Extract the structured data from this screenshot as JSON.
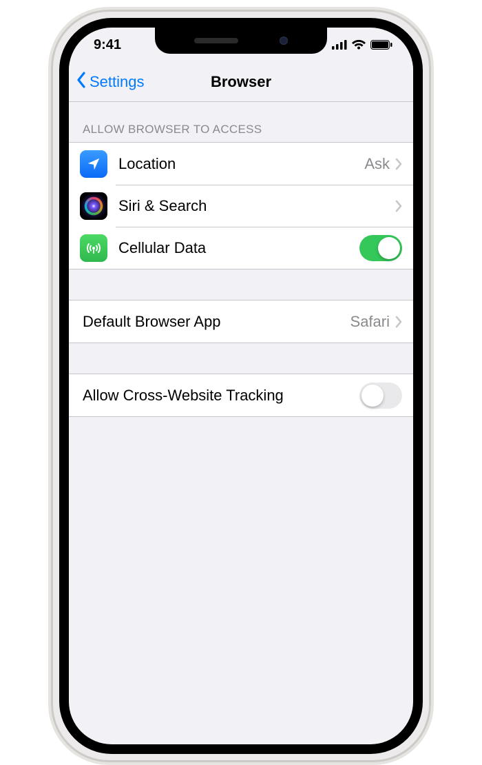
{
  "status": {
    "time": "9:41"
  },
  "nav": {
    "back_label": "Settings",
    "title": "Browser"
  },
  "section1": {
    "header": "ALLOW BROWSER TO ACCESS",
    "location": {
      "label": "Location",
      "value": "Ask"
    },
    "siri": {
      "label": "Siri & Search"
    },
    "cellular": {
      "label": "Cellular Data",
      "on": true
    }
  },
  "section2": {
    "default_browser": {
      "label": "Default Browser App",
      "value": "Safari"
    }
  },
  "section3": {
    "cross_site": {
      "label": "Allow Cross-Website Tracking",
      "on": false
    }
  }
}
